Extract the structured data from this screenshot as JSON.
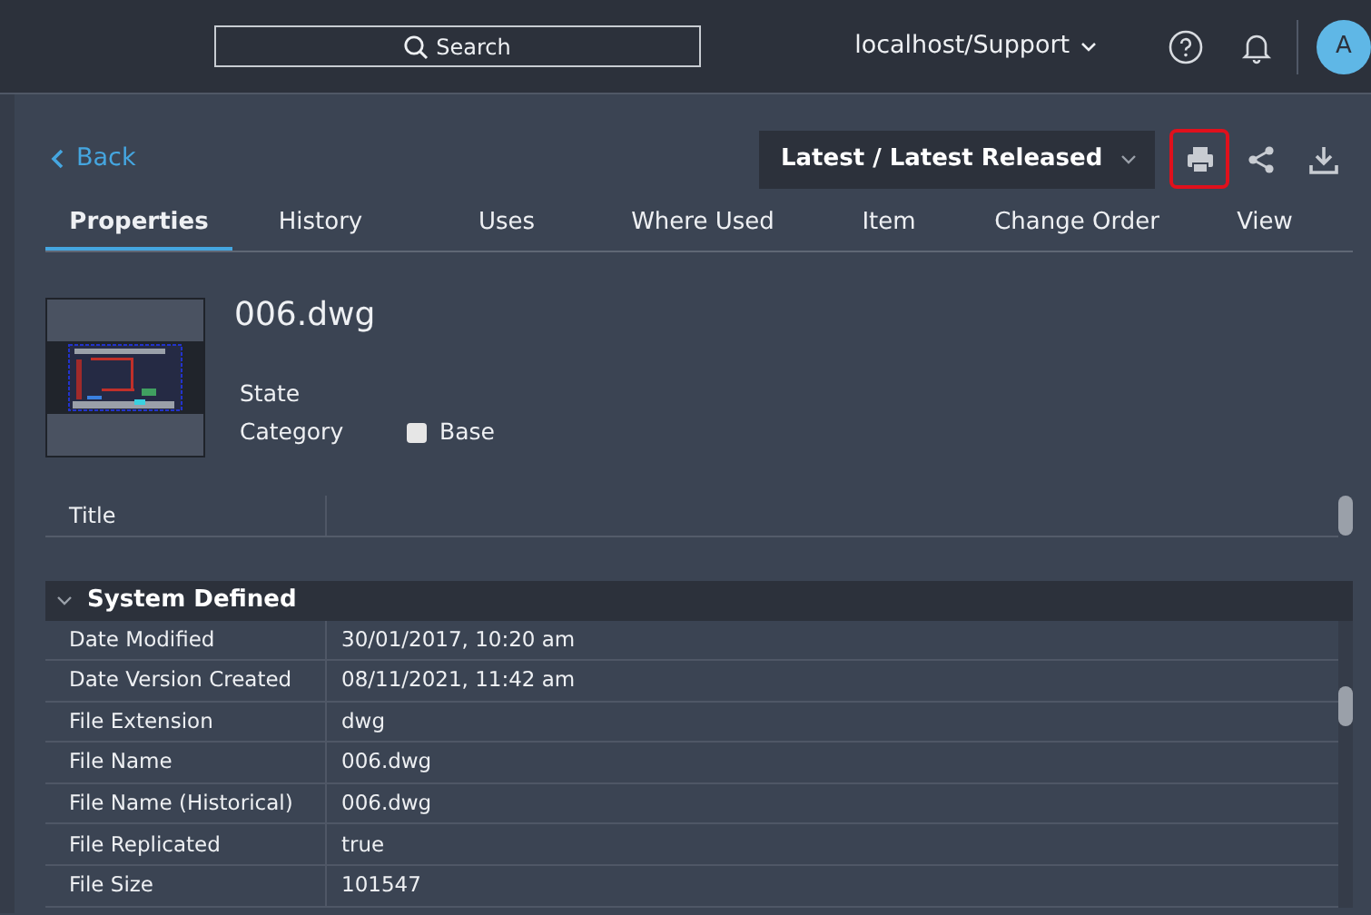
{
  "header": {
    "search_placeholder": "Search",
    "tenant": "localhost/Support",
    "avatar": "A"
  },
  "back": "Back",
  "version_select": {
    "value": "Latest / Latest Released"
  },
  "toolbar": [
    {
      "kind": "print",
      "selected": true
    },
    {
      "kind": "share",
      "selected": false
    },
    {
      "kind": "download",
      "selected": false
    }
  ],
  "tabs": [
    {
      "label": "Properties",
      "selected": true
    },
    {
      "label": "History",
      "selected": false
    },
    {
      "label": "Uses",
      "selected": false
    },
    {
      "label": "Where Used",
      "selected": false
    },
    {
      "label": "Item",
      "selected": false
    },
    {
      "label": "Change Order",
      "selected": false
    },
    {
      "label": "View",
      "selected": false
    }
  ],
  "file": {
    "title": "006.dwg",
    "fields": [
      {
        "label": "State"
      },
      {
        "label": "Category",
        "value": "Base",
        "color": "#e6e6e6"
      }
    ]
  },
  "title_row": {
    "label": "Title"
  },
  "section": {
    "title": "System Defined",
    "expanded": true,
    "rows": [
      {
        "name": "Date Modified",
        "value": "30/01/2017, 10:20 am"
      },
      {
        "name": "Date Version Created",
        "value": "08/11/2021, 11:42 am"
      },
      {
        "name": "File Extension",
        "value": "dwg"
      },
      {
        "name": "File Name",
        "value": "006.dwg"
      },
      {
        "name": "File Name (Historical)",
        "value": "006.dwg"
      },
      {
        "name": "File Replicated",
        "value": "true"
      },
      {
        "name": "File Size",
        "value": "101547"
      }
    ]
  }
}
